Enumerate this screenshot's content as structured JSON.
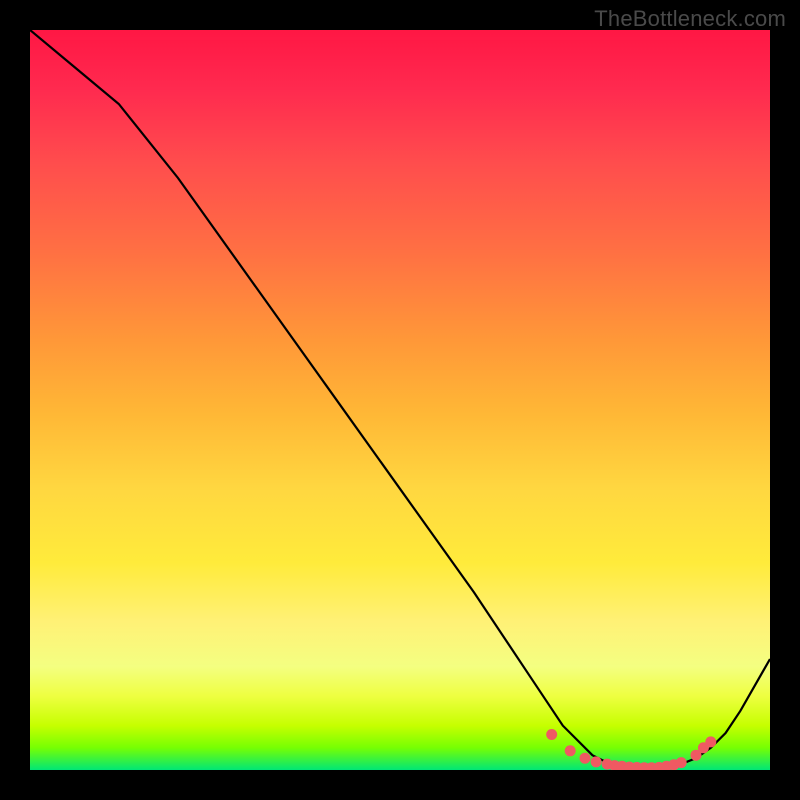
{
  "watermark": "TheBottleneck.com",
  "chart_data": {
    "type": "line",
    "title": "",
    "xlabel": "",
    "ylabel": "",
    "xlim": [
      0,
      100
    ],
    "ylim": [
      0,
      100
    ],
    "series": [
      {
        "name": "curve",
        "x": [
          0,
          6,
          12,
          20,
          30,
          40,
          50,
          60,
          68,
          72,
          76,
          78,
          80,
          82,
          84,
          86,
          88,
          90,
          92,
          94,
          96,
          100
        ],
        "values": [
          100,
          95,
          90,
          80,
          66,
          52,
          38,
          24,
          12,
          6,
          2,
          1,
          0.5,
          0.3,
          0.3,
          0.4,
          0.8,
          1.6,
          3,
          5,
          8,
          15
        ]
      }
    ],
    "markers": {
      "name": "dots",
      "x": [
        70.5,
        73,
        75,
        76.5,
        78,
        79,
        80,
        81,
        82,
        83,
        84,
        85,
        86,
        87,
        88,
        90,
        91,
        92
      ],
      "values": [
        4.8,
        2.6,
        1.6,
        1.1,
        0.8,
        0.6,
        0.5,
        0.4,
        0.35,
        0.3,
        0.3,
        0.35,
        0.5,
        0.7,
        1.0,
        2.0,
        3.0,
        3.8
      ]
    },
    "gradient_stops": [
      {
        "pos": 0,
        "color": "#ff1744"
      },
      {
        "pos": 50,
        "color": "#ffb836"
      },
      {
        "pos": 75,
        "color": "#ffeb3b"
      },
      {
        "pos": 100,
        "color": "#00e676"
      }
    ]
  }
}
